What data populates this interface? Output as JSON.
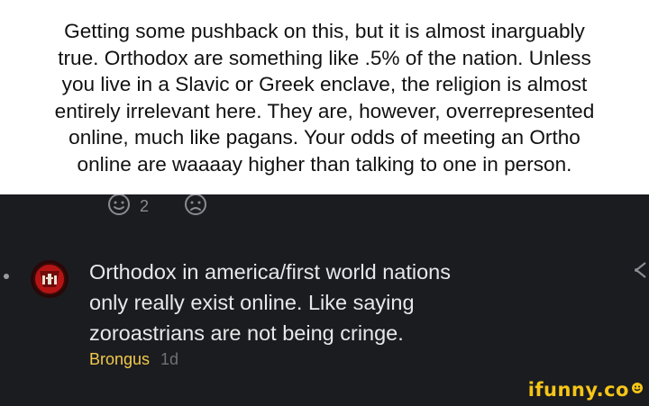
{
  "caption": {
    "lines": [
      "Getting some pushback on this, but it is almost inarguably",
      "true. Orthodox are something like .5% of the nation. Unless",
      "you live in a Slavic or Greek enclave, the religion is almost",
      "entirely irrelevant here. They are, however, overrepresented",
      "online, much like pagans. Your odds of meeting an Ortho",
      "online are waaaay higher than talking to one in person."
    ]
  },
  "reactions": {
    "happy_icon": "smile-icon",
    "happy_count": "2",
    "sad_icon": "frown-icon"
  },
  "comment": {
    "avatar_icon": "avatar",
    "lines": [
      "Orthodox in america/first world nations",
      "only really exist online. Like saying",
      "zoroastrians are not being cringe."
    ],
    "username": "Brongus",
    "timestamp": "1d",
    "share_icon": "share-icon"
  },
  "watermark": {
    "text": "ifunny.co"
  },
  "colors": {
    "background_dark": "#1b1c20",
    "comment_text": "#e8e8ea",
    "username": "#f2c94c",
    "muted": "#6f7075",
    "watermark": "#f5c518"
  }
}
